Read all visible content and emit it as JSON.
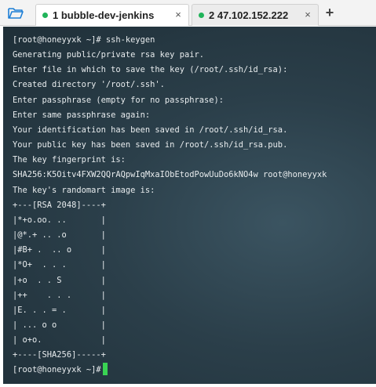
{
  "tabs": [
    {
      "label": "1 bubble-dev-jenkins",
      "close": "×",
      "status_color": "#21b45a"
    },
    {
      "label": "2 47.102.152.222",
      "close": "×",
      "status_color": "#21b45a"
    }
  ],
  "add_tab": "+",
  "terminal": {
    "lines": [
      "[root@honeyyxk ~]# ssh-keygen",
      "Generating public/private rsa key pair.",
      "Enter file in which to save the key (/root/.ssh/id_rsa):",
      "Created directory '/root/.ssh'.",
      "Enter passphrase (empty for no passphrase):",
      "Enter same passphrase again:",
      "Your identification has been saved in /root/.ssh/id_rsa.",
      "Your public key has been saved in /root/.ssh/id_rsa.pub.",
      "The key fingerprint is:",
      "SHA256:K5Oitv4FXW2QQrAQpwIqMxaIObEtodPowUuDo6kNO4w root@honeyyxk",
      "The key's randomart image is:",
      "+---[RSA 2048]----+",
      "|*+o.oo. ..       |",
      "|@*.+ .. .o       |",
      "|#B+ .  .. o      |",
      "|*O+  . . .       |",
      "|+o  . . S        |",
      "|++    . . .      |",
      "|E. . . = .       |",
      "| ... o o         |",
      "| o+o.            |",
      "+----[SHA256]-----+"
    ],
    "prompt": "[root@honeyyxk ~]#"
  },
  "colors": {
    "terminal_bg": "#2b3f4a",
    "terminal_text": "#e8ecee",
    "cursor": "#39d353",
    "active_dot": "#21b45a"
  }
}
